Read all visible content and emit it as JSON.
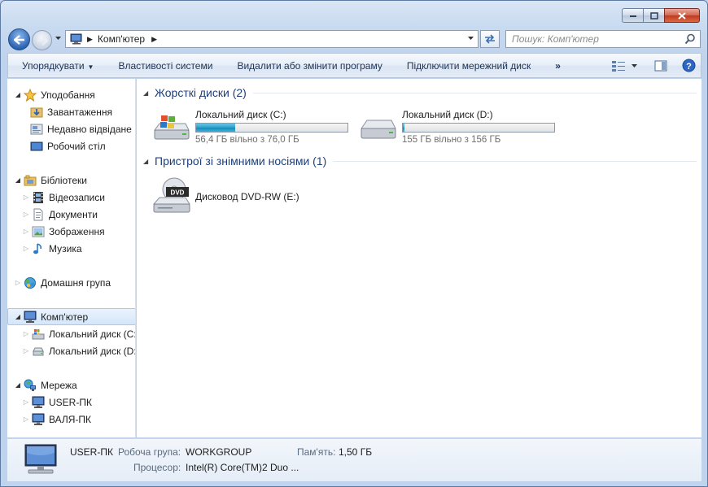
{
  "address": {
    "crumb": "Комп'ютер"
  },
  "search": {
    "placeholder": "Пошук: Комп'ютер"
  },
  "toolbar": {
    "organize": "Упорядкувати",
    "system_properties": "Властивості системи",
    "uninstall": "Видалити або змінити програму",
    "map_drive": "Підключити мережний диск",
    "more": "»"
  },
  "sidebar": {
    "favorites": {
      "label": "Уподобання",
      "items": [
        "Завантаження",
        "Недавно відвідане",
        "Робочий стіл"
      ]
    },
    "libraries": {
      "label": "Бібліотеки",
      "items": [
        "Відеозаписи",
        "Документи",
        "Зображення",
        "Музика"
      ]
    },
    "homegroup": {
      "label": "Домашня група"
    },
    "computer": {
      "label": "Комп'ютер",
      "items": [
        "Локальний диск (C:)",
        "Локальний диск (D:)"
      ]
    },
    "network": {
      "label": "Мережа",
      "items": [
        "USER-ПК",
        "ВАЛЯ-ПК"
      ]
    }
  },
  "groups": {
    "hard_disks": {
      "title": "Жорсткі диски (2)",
      "drives": [
        {
          "name": "Локальний диск (C:)",
          "space": "56,4 ГБ вільно з 76,0 ГБ",
          "used_fraction": 0.26
        },
        {
          "name": "Локальний диск (D:)",
          "space": "155 ГБ вільно з 156 ГБ",
          "used_fraction": 0.01
        }
      ]
    },
    "removable": {
      "title": "Пристрої зі знімними носіями (1)",
      "drives": [
        {
          "name": "Дисковод DVD-RW (E:)"
        }
      ]
    }
  },
  "details": {
    "computer_name": "USER-ПК",
    "workgroup_label": "Робоча група:",
    "workgroup_value": "WORKGROUP",
    "memory_label": "Пам'ять:",
    "memory_value": "1,50 ГБ",
    "processor_label": "Процесор:",
    "processor_value": "Intel(R) Core(TM)2 Duo ..."
  },
  "icons": {
    "dvd_label": "DVD"
  },
  "colors": {
    "accent_fill": "#2aa0cf",
    "group_header": "#1e3f7a",
    "selection": "#d4e6fb"
  }
}
